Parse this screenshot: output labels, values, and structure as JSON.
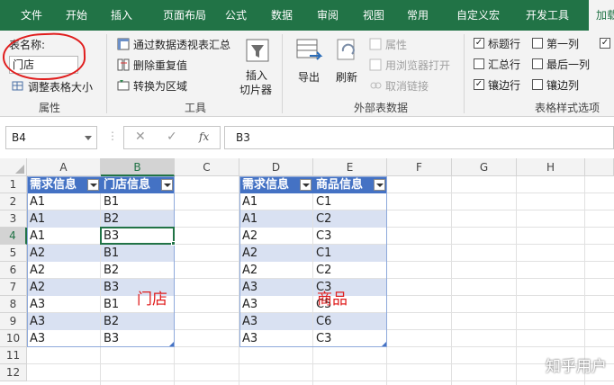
{
  "ribbon_tabs": [
    "文件",
    "开始",
    "插入",
    "页面布局",
    "公式",
    "数据",
    "审阅",
    "视图",
    "常用",
    "自定义宏",
    "开发工具",
    "加载"
  ],
  "active_tab_index": 11,
  "properties": {
    "name_label": "表名称:",
    "table_name": "门店",
    "resize_label": "调整表格大小",
    "group_label": "属性"
  },
  "tools": {
    "pivot_label": "通过数据透视表汇总",
    "dedupe_label": "删除重复值",
    "convert_label": "转换为区域",
    "slicer_label_1": "插入",
    "slicer_label_2": "切片器",
    "group_label": "工具"
  },
  "external": {
    "export_label": "导出",
    "refresh_label": "刷新",
    "props_label": "属性",
    "browser_label": "用浏览器打开",
    "unlink_label": "取消链接",
    "group_label": "外部表数据"
  },
  "style_options": {
    "header_row": {
      "label": "标题行",
      "checked": true
    },
    "first_col": {
      "label": "第一列",
      "checked": false
    },
    "total_row": {
      "label": "汇总行",
      "checked": false
    },
    "last_col": {
      "label": "最后一列",
      "checked": false
    },
    "banded_rows": {
      "label": "镶边行",
      "checked": true
    },
    "banded_cols": {
      "label": "镶边列",
      "checked": false
    },
    "extra_checked": true,
    "group_label": "表格样式选项"
  },
  "formula_bar": {
    "cell_ref": "B4",
    "cancel_glyph": "✕",
    "enter_glyph": "✓",
    "fx_glyph": "fx",
    "formula": "B3"
  },
  "columns": [
    "A",
    "B",
    "C",
    "D",
    "E",
    "F",
    "G",
    "H"
  ],
  "selected_column": "B",
  "rows": [
    "1",
    "2",
    "3",
    "4",
    "5",
    "6",
    "7",
    "8",
    "9",
    "10",
    "11",
    "12"
  ],
  "selected_row": "4",
  "table_store": {
    "headers": [
      "需求信息",
      "门店信息"
    ],
    "rows": [
      [
        "A1",
        "B1"
      ],
      [
        "A1",
        "B2"
      ],
      [
        "A1",
        "B3"
      ],
      [
        "A2",
        "B1"
      ],
      [
        "A2",
        "B2"
      ],
      [
        "A2",
        "B3"
      ],
      [
        "A3",
        "B1"
      ],
      [
        "A3",
        "B2"
      ],
      [
        "A3",
        "B3"
      ]
    ]
  },
  "table_product": {
    "headers": [
      "需求信息",
      "商品信息"
    ],
    "rows": [
      [
        "A1",
        "C1"
      ],
      [
        "A1",
        "C2"
      ],
      [
        "A2",
        "C3"
      ],
      [
        "A2",
        "C1"
      ],
      [
        "A2",
        "C2"
      ],
      [
        "A3",
        "C3"
      ],
      [
        "A3",
        "C5"
      ],
      [
        "A3",
        "C6"
      ],
      [
        "A3",
        "C3"
      ]
    ]
  },
  "annotations": {
    "store_label": "门店",
    "product_label": "商品"
  },
  "watermark": "知乎用户",
  "colors": {
    "ribbon_green": "#217346",
    "header_blue": "#4472c4",
    "band_blue": "#d9e1f2",
    "annotation_red": "#e01d1d"
  }
}
